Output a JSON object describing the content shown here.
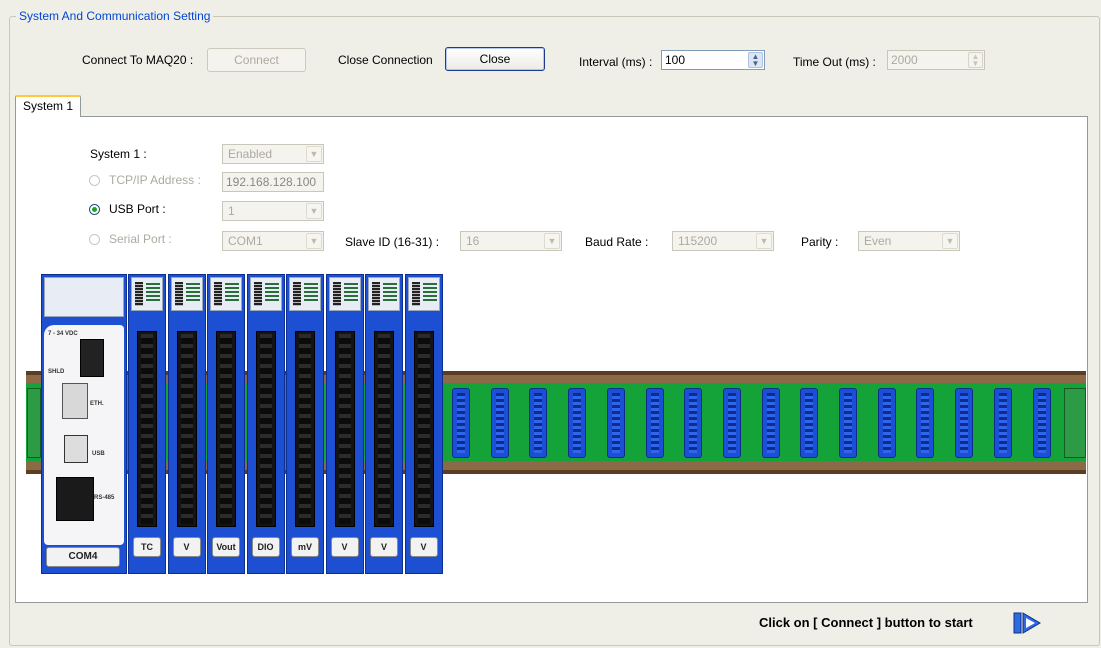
{
  "group": {
    "title": "System And Communication Setting"
  },
  "toolbar": {
    "connect_label": "Connect To MAQ20 :",
    "connect_button": "Connect",
    "close_label": "Close Connection",
    "close_button": "Close",
    "interval_label": "Interval (ms) :",
    "interval_value": "100",
    "timeout_label": "Time Out (ms) :",
    "timeout_value": "2000"
  },
  "tabs": [
    {
      "label": "System 1"
    }
  ],
  "system": {
    "label": "System 1 :",
    "state": "Enabled",
    "tcp_label": "TCP/IP Address :",
    "tcp_value": "192.168.128.100",
    "usb_label": "USB Port :",
    "usb_value": "1",
    "serial_label": "Serial  Port :",
    "serial_value": "COM1",
    "slave_label": "Slave ID (16-31) :",
    "slave_value": "16",
    "baud_label": "Baud Rate :",
    "baud_value": "115200",
    "parity_label": "Parity :",
    "parity_value": "Even",
    "selected_port": "usb"
  },
  "hardware": {
    "comm_module_label": "COM4",
    "comm_text": {
      "vdc": "7 - 34 VDC",
      "shld": "SHLD",
      "eth": "ETH.",
      "usb": "USB",
      "rs485": "RS-485"
    },
    "io_modules": [
      "TC",
      "V",
      "Vout",
      "DIO",
      "mV",
      "V",
      "V",
      "V"
    ]
  },
  "footer": {
    "hint": "Click on [ Connect ] button to start"
  },
  "icons": {
    "next": "next-arrow-icon"
  },
  "colors": {
    "group_title": "#0046d5",
    "module_blue": "#1d4fd2",
    "rail_green": "#14a338",
    "tab_highlight": "#ffc83c"
  }
}
